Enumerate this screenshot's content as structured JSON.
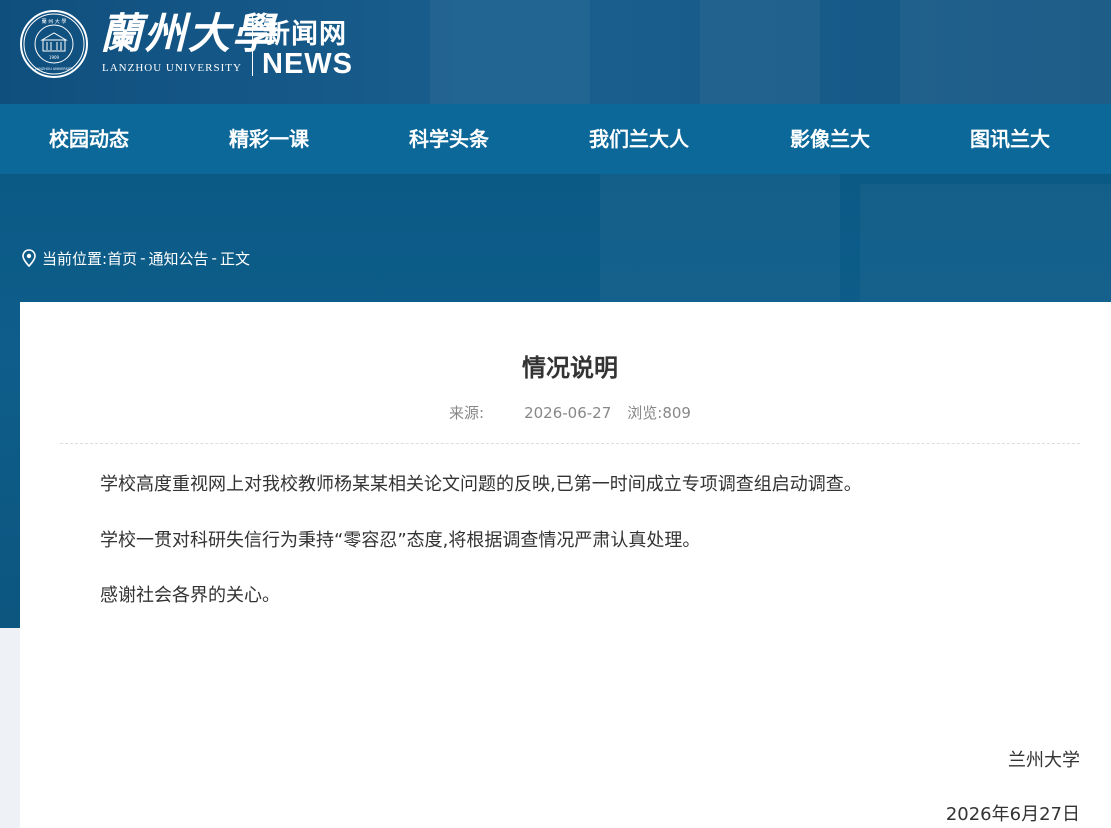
{
  "header": {
    "brand_cn": "蘭州大學",
    "brand_en": "LANZHOU UNIVERSITY",
    "site_name": "新闻网",
    "site_name_en": "NEWS",
    "seal_text_top": "蘭 州 大 學",
    "seal_text_bottom": "LANZHOU UNIVERSITY",
    "seal_year": "1909"
  },
  "nav": {
    "items": [
      {
        "label": "校园动态"
      },
      {
        "label": "精彩一课"
      },
      {
        "label": "科学头条"
      },
      {
        "label": "我们兰大人"
      },
      {
        "label": "影像兰大"
      },
      {
        "label": "图讯兰大"
      }
    ]
  },
  "breadcrumb": {
    "prefix": "当前位置:",
    "home": "首页",
    "separator": "-",
    "section": "通知公告",
    "current": "正文"
  },
  "article": {
    "title": "情况说明",
    "source_label": "来源:",
    "date": "2026-06-27",
    "views_label": "浏览:",
    "views": "809",
    "paragraphs": [
      "学校高度重视网上对我校教师杨某某相关论文问题的反映,已第一时间成立专项调查组启动调查。",
      "学校一贯对科研失信行为秉持“零容忍”态度,将根据调查情况严肃认真处理。",
      "感谢社会各界的关心。"
    ],
    "signature": "兰州大学",
    "sign_date": "2026年6月27日"
  },
  "colors": {
    "header_bg": "#155784",
    "nav_bg": "#0b6898",
    "banner_bg": "#0c5680",
    "text": "#333333",
    "meta_text": "#888888"
  },
  "icons": {
    "breadcrumb": "location-pin-icon",
    "logo": "university-seal-icon"
  }
}
